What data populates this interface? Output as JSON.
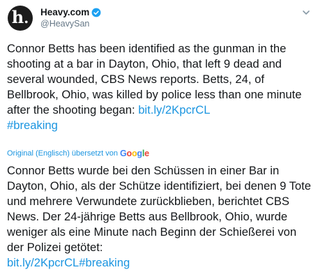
{
  "account": {
    "display_name": "Heavy.com",
    "handle": "@HeavySan",
    "avatar_letter": "h",
    "avatar_dot": ".",
    "verified_icon": "verified-badge-icon",
    "menu_icon": "chevron-down-icon"
  },
  "tweet": {
    "text": "Connor Betts has been identified as the gunman in the shooting at a bar in Dayton, Ohio, that left 9 dead and several wounded, CBS News reports. Betts, 24, of Bellbrook, Ohio, was killed by police less than one minute after the shooting began: ",
    "link": "bit.ly/2KpcrCL",
    "hashtag": "#breaking"
  },
  "translation": {
    "label": "Original (Englisch) übersetzt von",
    "provider": [
      "G",
      "o",
      "o",
      "g",
      "l",
      "e"
    ],
    "text": "Connor Betts wurde bei den Schüssen in einer Bar in Dayton, Ohio, als der Schütze identifiziert, bei denen 9 Tote und mehrere Verwundete zurückblieben, berichtet CBS News. Der 24-jährige Betts aus Bellbrook, Ohio, wurde weniger als eine Minute nach Beginn der Schießerei von der Polizei getötet: ",
    "link": "bit.ly/2KpcrCL",
    "hashtag": "#breaking"
  },
  "colors": {
    "link": "#1b95e0",
    "text": "#14171a",
    "secondary": "#657786"
  }
}
